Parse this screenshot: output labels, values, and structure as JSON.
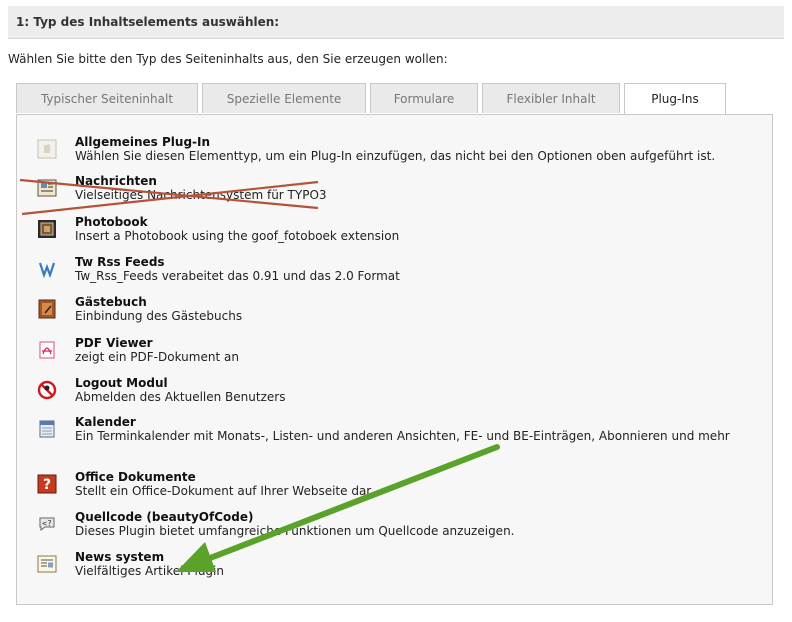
{
  "header": {
    "title": "1: Typ des Inhaltselements auswählen:"
  },
  "intro": "Wählen Sie bitte den Typ des Seiteninhalts aus, den Sie erzeugen wollen:",
  "tabs": [
    {
      "label": "Typischer Seiteninhalt"
    },
    {
      "label": "Spezielle Elemente"
    },
    {
      "label": "Formulare"
    },
    {
      "label": "Flexibler Inhalt"
    },
    {
      "label": "Plug-Ins"
    }
  ],
  "active_tab": "Plug-Ins",
  "items": [
    {
      "title": "Allgemeines Plug-In",
      "desc": "Wählen Sie diesen Elementtyp, um ein Plug-In einzufügen, das nicht bei den Optionen oben aufgeführt ist.",
      "icon": "puzzle-icon"
    },
    {
      "title": "Nachrichten",
      "desc": "Vielseitiges Nachrichtensystem für TYPO3",
      "icon": "news-icon"
    },
    {
      "title": "Photobook",
      "desc": "Insert a Photobook using the goof_fotoboek extension",
      "icon": "photobook-icon"
    },
    {
      "title": "Tw Rss Feeds",
      "desc": "Tw_Rss_Feeds verabeitet das 0.91 und das 2.0 Format",
      "icon": "rss-icon"
    },
    {
      "title": "Gästebuch",
      "desc": "Einbindung des Gästebuchs",
      "icon": "guestbook-icon"
    },
    {
      "title": "PDF Viewer",
      "desc": "zeigt ein PDF-Dokument an",
      "icon": "pdf-icon"
    },
    {
      "title": "Logout Modul",
      "desc": "Abmelden des Aktuellen Benutzers",
      "icon": "logout-icon"
    },
    {
      "title": "Kalender",
      "desc": "Ein Terminkalender mit Monats-, Listen- und anderen Ansichten, FE- und BE-Einträgen, Abonnieren und mehr",
      "icon": "calendar-icon"
    },
    {
      "title": "Office Dokumente",
      "desc": "Stellt ein Office-Dokument auf Ihrer Webseite dar.",
      "icon": "office-icon"
    },
    {
      "title": "Quellcode (beautyOfCode)",
      "desc": "Dieses Plugin bietet umfangreiche Funktionen um Quellcode anzuzeigen.",
      "icon": "code-icon"
    },
    {
      "title": "News system",
      "desc": "Vielfältiges Artikel Plugin",
      "icon": "newssystem-icon"
    }
  ],
  "colors": {
    "strike": "#b5533a",
    "arrow": "#5aa22a"
  }
}
